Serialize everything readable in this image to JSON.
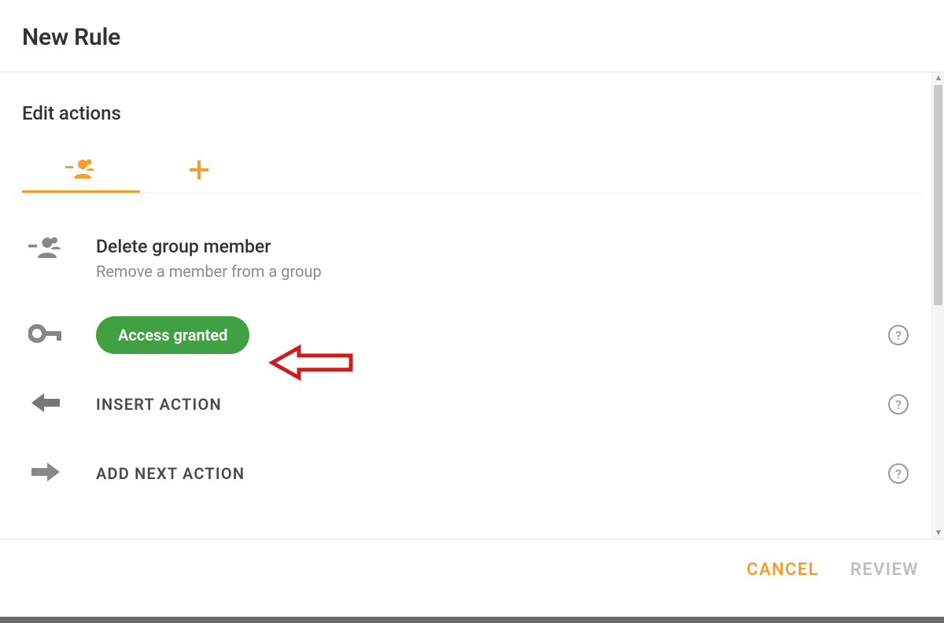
{
  "colors": {
    "accent": "#f79c2d",
    "chip_bg": "#40a142",
    "annotation": "#cc1c1c",
    "muted": "#8a8a8a"
  },
  "header": {
    "title": "New Rule"
  },
  "section": {
    "title": "Edit actions"
  },
  "tabs": {
    "active": "remove-member",
    "remove_member_icon": "person-remove-icon",
    "add_icon": "plus-icon"
  },
  "action": {
    "title": "Delete group member",
    "subtitle": "Remove a member from a group"
  },
  "access": {
    "chip_label": "Access granted"
  },
  "rows": {
    "insert": "INSERT ACTION",
    "add_next": "ADD NEXT ACTION"
  },
  "footer": {
    "cancel": "CANCEL",
    "review": "REVIEW"
  },
  "help": {
    "glyph": "?"
  }
}
